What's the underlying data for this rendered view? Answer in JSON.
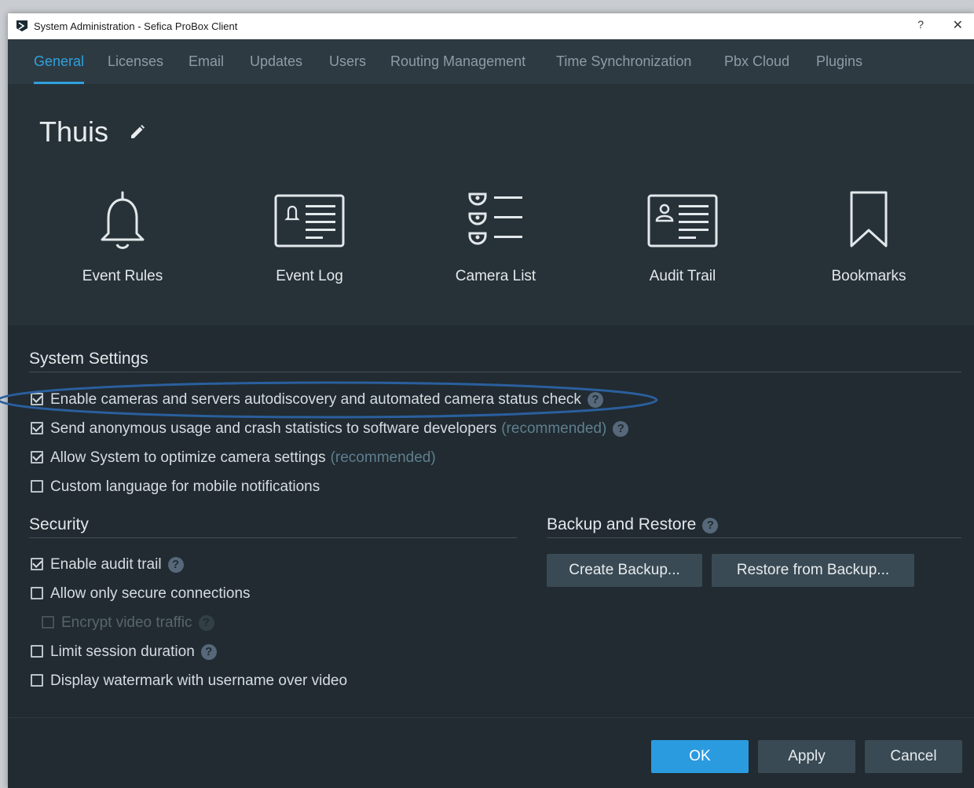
{
  "window": {
    "title": "System Administration - Sefica ProBox Client",
    "help": "?",
    "close": "✕"
  },
  "tabs": [
    "General",
    "Licenses",
    "Email",
    "Updates",
    "Users",
    "Routing Management",
    "Time Synchronization",
    "Pbx Cloud",
    "Plugins"
  ],
  "system_name": "Thuis",
  "tiles": [
    "Event Rules",
    "Event Log",
    "Camera List",
    "Audit Trail",
    "Bookmarks"
  ],
  "system_settings": {
    "title": "System Settings",
    "options": [
      {
        "label": "Enable cameras and servers autodiscovery and automated camera status check",
        "checked": true,
        "help": "?"
      },
      {
        "label": "Send anonymous usage and crash statistics to software developers",
        "note": "(recommended)",
        "checked": true,
        "help": "?"
      },
      {
        "label": "Allow System to optimize camera settings",
        "note": "(recommended)",
        "checked": true
      },
      {
        "label": "Custom language for mobile notifications",
        "checked": false
      }
    ]
  },
  "security": {
    "title": "Security",
    "options": [
      {
        "label": "Enable audit trail",
        "checked": true,
        "help": "?"
      },
      {
        "label": "Allow only secure connections",
        "checked": false
      },
      {
        "label": "Encrypt video traffic",
        "checked": false,
        "disabled": true,
        "help": "?"
      },
      {
        "label": "Limit session duration",
        "checked": false,
        "help": "?"
      },
      {
        "label": "Display watermark with username over video",
        "checked": false
      }
    ]
  },
  "backup": {
    "title": "Backup and Restore",
    "help": "?",
    "create_label": "Create Backup...",
    "restore_label": "Restore from Backup..."
  },
  "footer": {
    "ok_label": "OK",
    "apply_label": "Apply",
    "cancel_label": "Cancel"
  },
  "colors": {
    "accent": "#2fa2de",
    "background": "#212b31",
    "annotation": "#2a5f9e"
  }
}
